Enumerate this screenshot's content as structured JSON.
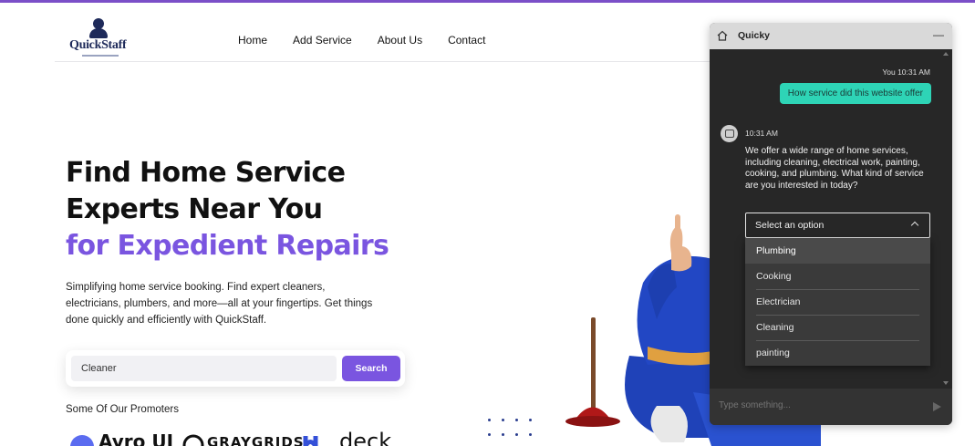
{
  "brand": {
    "name": "QuickStaff",
    "accent_color": "#7a55e0"
  },
  "nav": {
    "home": "Home",
    "add_service": "Add Service",
    "about": "About Us",
    "contact": "Contact"
  },
  "hero": {
    "title_line1": "Find Home Service",
    "title_line2": "Experts Near You",
    "title_accent": "for Expedient Repairs",
    "description": "Simplifying home service booking. Find expert cleaners, electricians, plumbers, and more—all at your fingertips. Get things done quickly and efficiently with QuickStaff."
  },
  "search": {
    "value": "Cleaner",
    "button_label": "Search"
  },
  "promoters": {
    "label": "Some Of Our Promoters",
    "logos": [
      "Ayro UI",
      "GRAYGRIDS",
      "deck"
    ]
  },
  "chat": {
    "title": "Quicky",
    "minimize_label": "—",
    "user_meta": "You 10:31 AM",
    "user_message": "How service did this website offer",
    "bot_meta": "10:31 AM",
    "bot_message": "We offer a wide range of home services, including cleaning, electrical work, painting, cooking, and plumbing. What kind of service are you interested in today?",
    "select_label": "Select an option",
    "options": [
      "Plumbing",
      "Cooking",
      "Electrician",
      "Cleaning",
      "painting"
    ],
    "input_placeholder": "Type something..."
  },
  "icons": {
    "chat_home": "home-icon",
    "send": "send-icon",
    "select_toggle": "chevron-up-icon"
  }
}
